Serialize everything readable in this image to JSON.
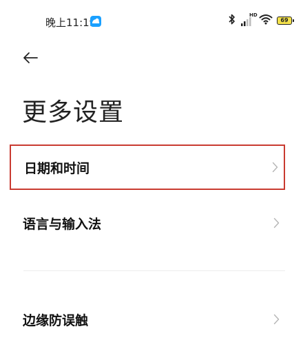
{
  "status_bar": {
    "time": "晚上11:19",
    "hd_label": "HD",
    "battery_level": "69",
    "icons": [
      "app-notification-icon",
      "bluetooth-icon",
      "signal-icon",
      "wifi-icon",
      "battery-icon"
    ]
  },
  "header": {
    "back_icon": "back-arrow-icon",
    "title": "更多设置"
  },
  "settings": {
    "items": [
      {
        "label": "日期和时间",
        "selected": true
      },
      {
        "label": "语言与输入法",
        "selected": false
      },
      {
        "label": "边缘防误触",
        "selected": false
      }
    ]
  },
  "colors": {
    "highlight_border": "#c9392f",
    "notification_icon": "#1aa0ff",
    "battery_fill": "#f3e14b"
  }
}
